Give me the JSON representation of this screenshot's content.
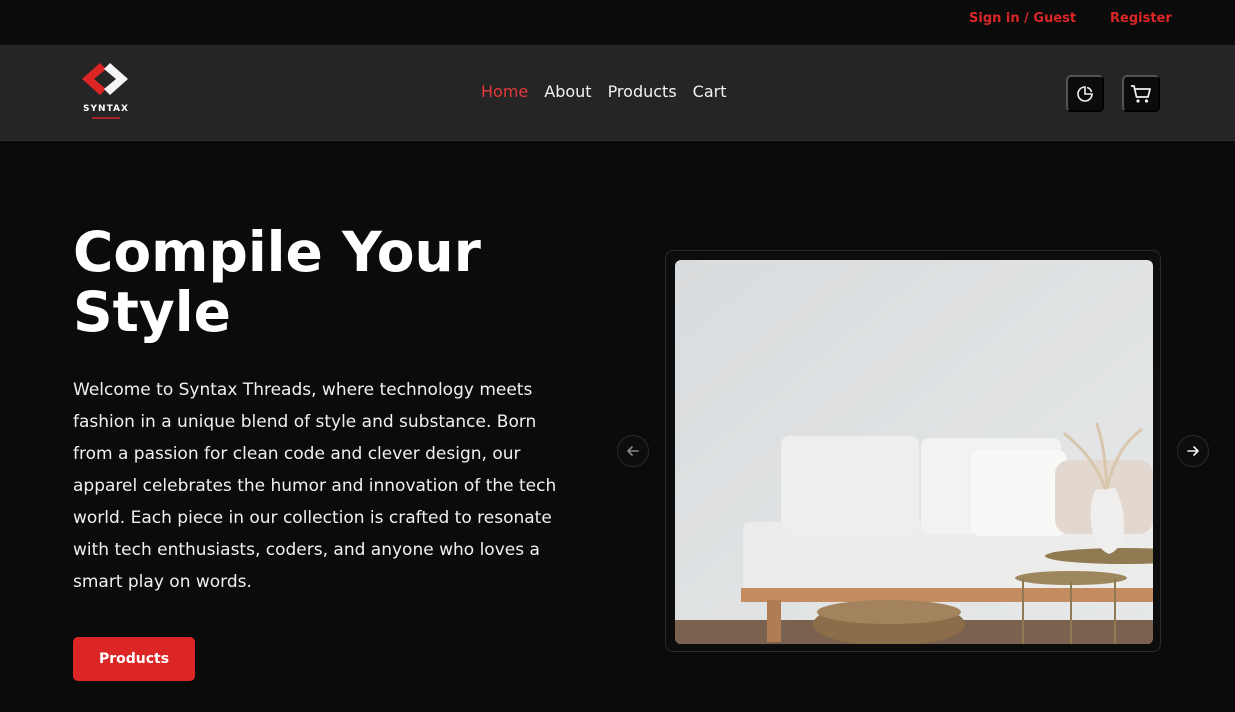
{
  "topbar": {
    "signin_label": "Sign in / Guest",
    "register_label": "Register"
  },
  "brand": {
    "name": "SYNTAX",
    "accent_color": "#dc2626"
  },
  "nav": {
    "items": [
      {
        "label": "Home",
        "active": true
      },
      {
        "label": "About",
        "active": false
      },
      {
        "label": "Products",
        "active": false
      },
      {
        "label": "Cart",
        "active": false
      }
    ]
  },
  "actions": {
    "theme_icon": "theme-toggle-icon",
    "cart_icon": "cart-icon"
  },
  "hero": {
    "title": "Compile Your Style",
    "description": "Welcome to Syntax Threads, where technology meets fashion in a unique blend of style and substance. Born from a passion for clean code and clever design, our apparel celebrates the humor and innovation of the tech world. Each piece in our collection is crafted to resonate with tech enthusiasts, coders, and anyone who loves a smart play on words.",
    "cta_label": "Products"
  },
  "carousel": {
    "prev_icon": "arrow-left-icon",
    "next_icon": "arrow-right-icon"
  }
}
